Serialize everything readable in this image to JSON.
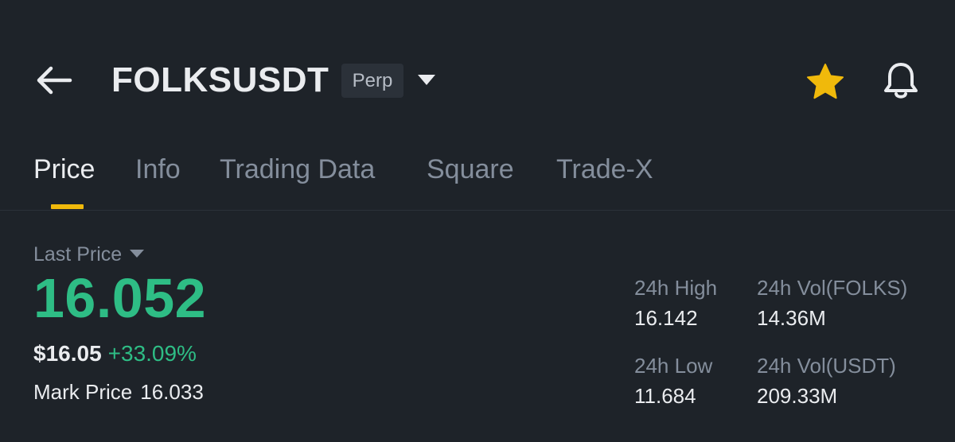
{
  "header": {
    "symbol": "FOLKSUSDT",
    "contract_type": "Perp",
    "favorite_color": "#f0b90b"
  },
  "tabs": [
    {
      "label": "Price",
      "active": true
    },
    {
      "label": "Info",
      "active": false
    },
    {
      "label": "Trading Data",
      "active": false
    },
    {
      "label": "Square",
      "active": false
    },
    {
      "label": "Trade-X",
      "active": false
    }
  ],
  "price": {
    "label": "Last Price",
    "last": "16.052",
    "fiat": "$16.05",
    "change": "+33.09%",
    "mark_label": "Mark Price",
    "mark": "16.033"
  },
  "stats": {
    "high_label": "24h High",
    "high": "16.142",
    "vol_base_label": "24h Vol(FOLKS)",
    "vol_base": "14.36M",
    "low_label": "24h Low",
    "low": "11.684",
    "vol_quote_label": "24h Vol(USDT)",
    "vol_quote": "209.33M"
  },
  "colors": {
    "background": "#1e2329",
    "positive": "#2ebd85",
    "accent": "#f0b90b",
    "muted": "#848e9c",
    "text": "#eaecef"
  }
}
